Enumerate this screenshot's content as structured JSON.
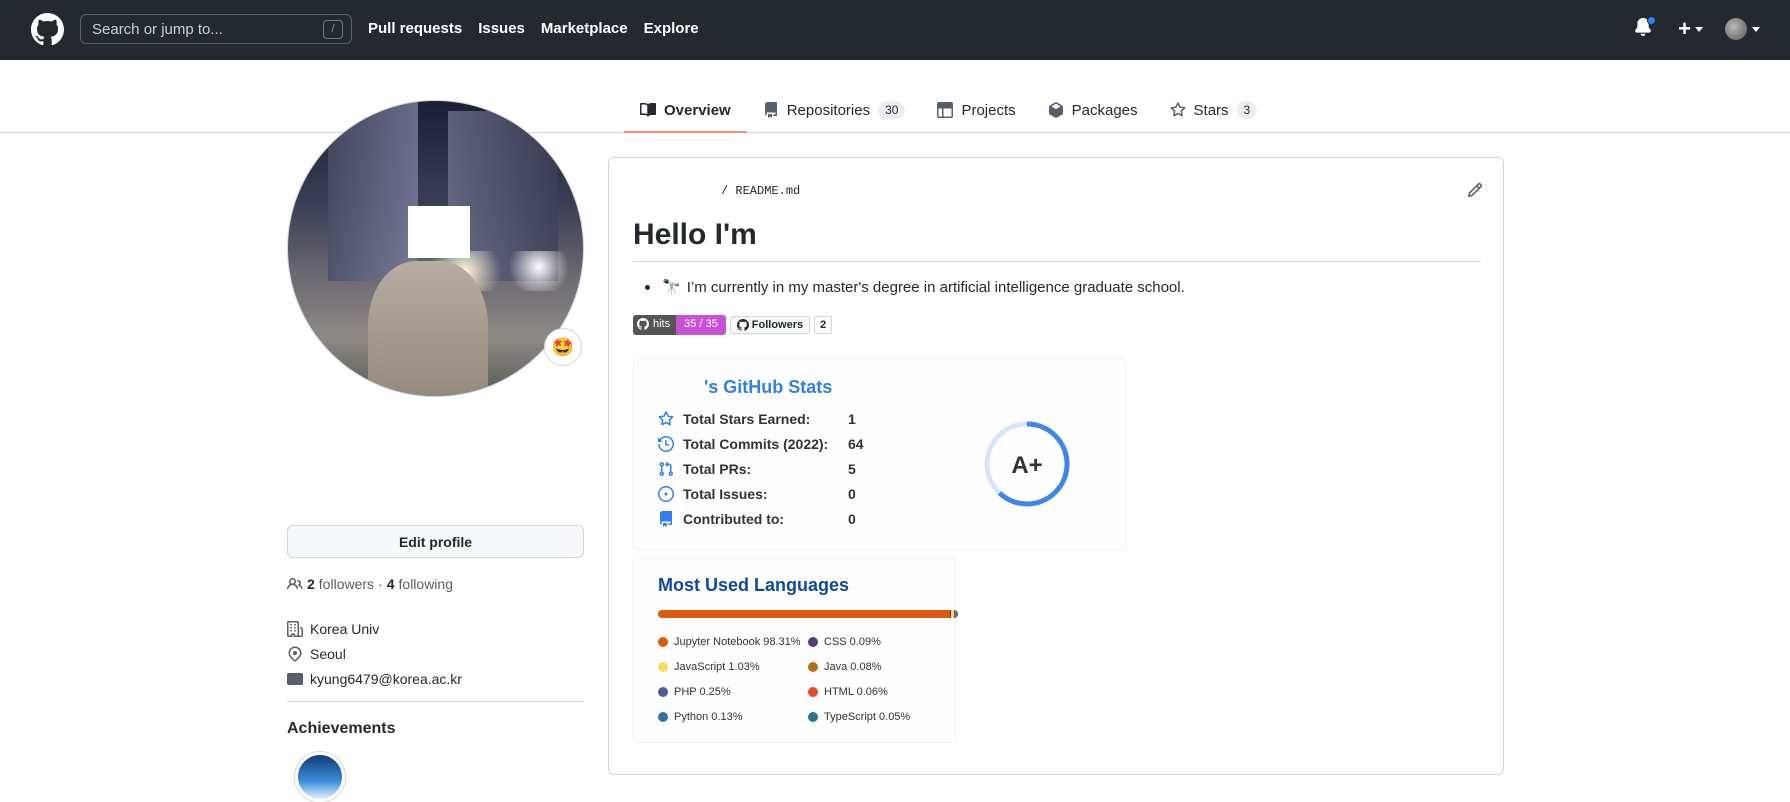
{
  "header": {
    "search_placeholder": "Search or jump to...",
    "search_shortcut": "/",
    "nav": [
      "Pull requests",
      "Issues",
      "Marketplace",
      "Explore"
    ]
  },
  "tabs": [
    {
      "label": "Overview",
      "count": null,
      "icon": "book-icon"
    },
    {
      "label": "Repositories",
      "count": "30",
      "icon": "repo-icon"
    },
    {
      "label": "Projects",
      "count": null,
      "icon": "table-icon"
    },
    {
      "label": "Packages",
      "count": null,
      "icon": "package-icon"
    },
    {
      "label": "Stars",
      "count": "3",
      "icon": "star-icon"
    }
  ],
  "sidebar": {
    "status_emoji": "🤩",
    "edit_profile": "Edit profile",
    "followers_count": "2",
    "followers_label": "followers",
    "separator": "·",
    "following_count": "4",
    "following_label": "following",
    "organization": "Korea Univ",
    "location": "Seoul",
    "email": "kyung6479@korea.ac.kr",
    "achievements_title": "Achievements"
  },
  "readme": {
    "path_prefix": "/",
    "path_file": "README.md",
    "heading": "Hello I'm",
    "bullet_emoji": "🔭",
    "bullet_text": "I’m currently in my master's degree in artificial intelligence graduate school.",
    "hits_label": "hits",
    "hits_value": "35 / 35",
    "followers_badge_label": "Followers",
    "followers_badge_value": "2"
  },
  "stats": {
    "title": "'s GitHub Stats",
    "rows": [
      {
        "label": "Total Stars Earned:",
        "value": "1",
        "icon": "star-icon"
      },
      {
        "label": "Total Commits (2022):",
        "value": "64",
        "icon": "history-icon"
      },
      {
        "label": "Total PRs:",
        "value": "5",
        "icon": "pull-request-icon"
      },
      {
        "label": "Total Issues:",
        "value": "0",
        "icon": "issue-icon"
      },
      {
        "label": "Contributed to:",
        "value": "0",
        "icon": "repo-icon"
      }
    ],
    "grade": "A+",
    "grade_progress": 0.62,
    "accent": "#2f80ed"
  },
  "languages": {
    "title": "Most Used Languages",
    "items": [
      {
        "name": "Jupyter Notebook",
        "percent": 98.31,
        "label": "Jupyter Notebook 98.31%",
        "color": "#DA5B0B"
      },
      {
        "name": "CSS",
        "percent": 0.09,
        "label": "CSS 0.09%",
        "color": "#563d7c"
      },
      {
        "name": "JavaScript",
        "percent": 1.03,
        "label": "JavaScript 1.03%",
        "color": "#f1e05a"
      },
      {
        "name": "Java",
        "percent": 0.08,
        "label": "Java 0.08%",
        "color": "#b07219"
      },
      {
        "name": "PHP",
        "percent": 0.25,
        "label": "PHP 0.25%",
        "color": "#4F5D95"
      },
      {
        "name": "HTML",
        "percent": 0.06,
        "label": "HTML 0.06%",
        "color": "#e34c26"
      },
      {
        "name": "Python",
        "percent": 0.13,
        "label": "Python 0.13%",
        "color": "#3572A5"
      },
      {
        "name": "TypeScript",
        "percent": 0.05,
        "label": "TypeScript 0.05%",
        "color": "#2b7489"
      }
    ]
  }
}
